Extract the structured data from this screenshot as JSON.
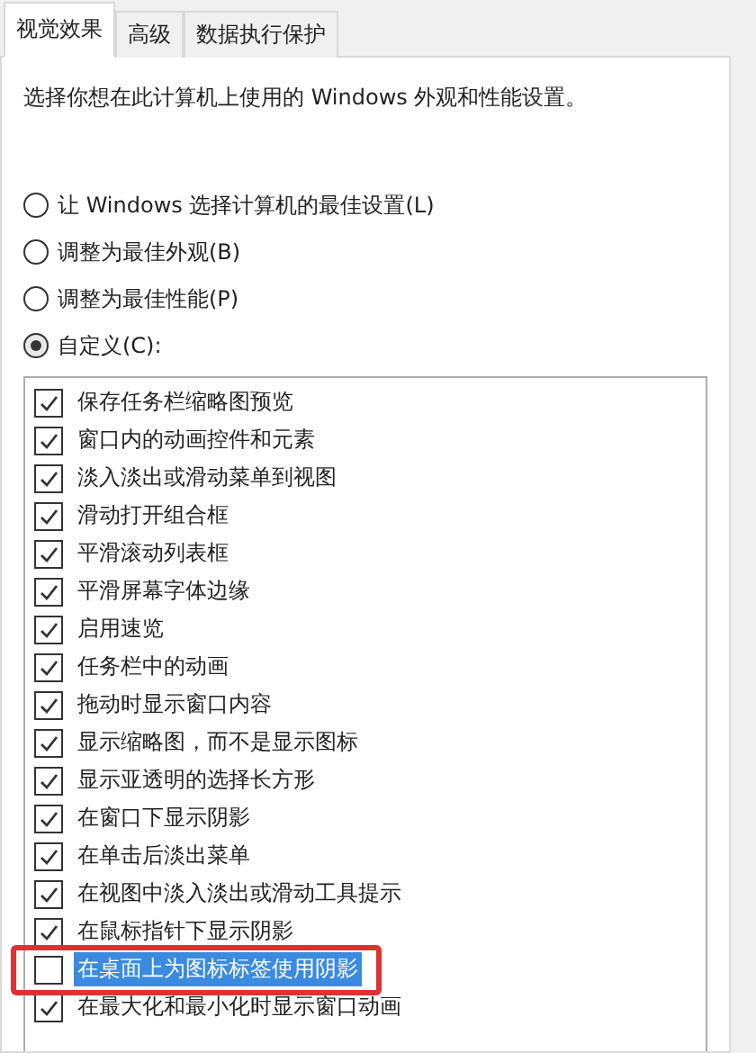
{
  "tabs": [
    {
      "label": "视觉效果",
      "selected": true
    },
    {
      "label": "高级",
      "selected": false
    },
    {
      "label": "数据执行保护",
      "selected": false
    }
  ],
  "description": "选择你想在此计算机上使用的 Windows 外观和性能设置。",
  "options": [
    {
      "label": "让 Windows 选择计算机的最佳设置(L)",
      "selected": false
    },
    {
      "label": "调整为最佳外观(B)",
      "selected": false
    },
    {
      "label": "调整为最佳性能(P)",
      "selected": false
    },
    {
      "label": "自定义(C):",
      "selected": true
    }
  ],
  "effects": [
    {
      "label": "保存任务栏缩略图预览",
      "checked": true,
      "selected": false
    },
    {
      "label": "窗口内的动画控件和元素",
      "checked": true,
      "selected": false
    },
    {
      "label": "淡入淡出或滑动菜单到视图",
      "checked": true,
      "selected": false
    },
    {
      "label": "滑动打开组合框",
      "checked": true,
      "selected": false
    },
    {
      "label": "平滑滚动列表框",
      "checked": true,
      "selected": false
    },
    {
      "label": "平滑屏幕字体边缘",
      "checked": true,
      "selected": false
    },
    {
      "label": "启用速览",
      "checked": true,
      "selected": false
    },
    {
      "label": "任务栏中的动画",
      "checked": true,
      "selected": false
    },
    {
      "label": "拖动时显示窗口内容",
      "checked": true,
      "selected": false
    },
    {
      "label": "显示缩略图，而不是显示图标",
      "checked": true,
      "selected": false
    },
    {
      "label": "显示亚透明的选择长方形",
      "checked": true,
      "selected": false
    },
    {
      "label": "在窗口下显示阴影",
      "checked": true,
      "selected": false
    },
    {
      "label": "在单击后淡出菜单",
      "checked": true,
      "selected": false
    },
    {
      "label": "在视图中淡入淡出或滑动工具提示",
      "checked": true,
      "selected": false
    },
    {
      "label": "在鼠标指针下显示阴影",
      "checked": true,
      "selected": false
    },
    {
      "label": "在桌面上为图标标签使用阴影",
      "checked": false,
      "selected": true,
      "highlighted": true
    },
    {
      "label": "在最大化和最小化时显示窗口动画",
      "checked": true,
      "selected": false
    }
  ]
}
